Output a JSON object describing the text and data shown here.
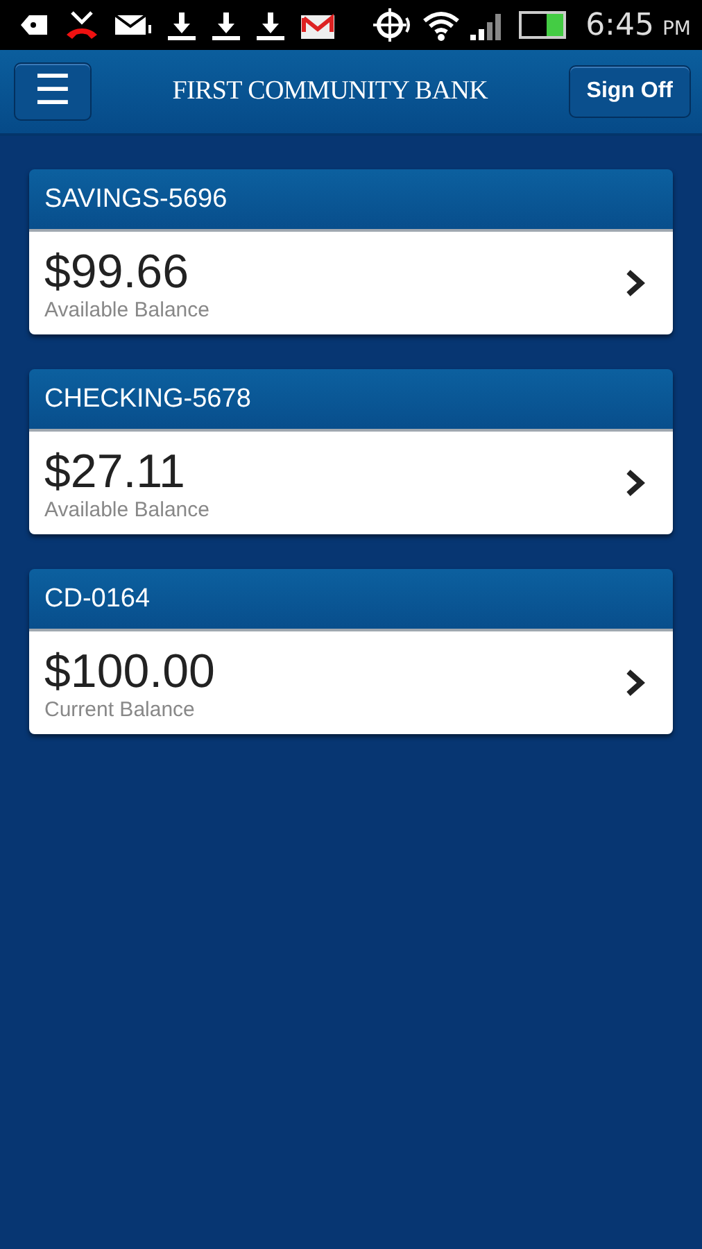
{
  "status_bar": {
    "time": "6:45",
    "meridiem": "PM"
  },
  "header": {
    "menu_label": "☰",
    "title": "FIRST COMMUNITY BANK",
    "sign_off": "Sign Off"
  },
  "accounts": [
    {
      "name": "SAVINGS-5696",
      "amount": "$99.66",
      "balance_label": "Available Balance"
    },
    {
      "name": "CHECKING-5678",
      "amount": "$27.11",
      "balance_label": "Available Balance"
    },
    {
      "name": "CD-0164",
      "amount": "$100.00",
      "balance_label": "Current Balance"
    }
  ]
}
